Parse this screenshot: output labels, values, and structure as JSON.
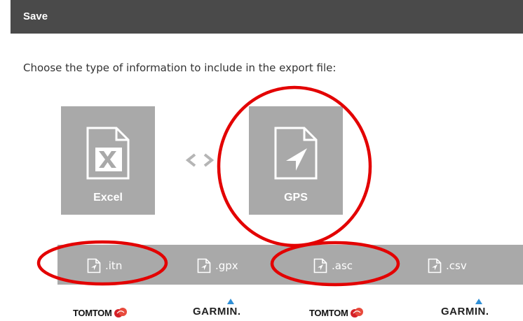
{
  "dialog": {
    "title": "Save"
  },
  "instructions": "Choose the type of information to include in the export file:",
  "tiles": [
    {
      "label": "Excel",
      "icon": "excel-doc-icon"
    },
    {
      "label": "GPS",
      "icon": "gps-doc-icon"
    }
  ],
  "toggle_icon": "swap-arrows-icon",
  "formats": [
    {
      "label": ".itn",
      "icon": "file-gps-icon"
    },
    {
      "label": ".gpx",
      "icon": "file-gps-icon"
    },
    {
      "label": ".asc",
      "icon": "file-gps-icon"
    },
    {
      "label": ".csv",
      "icon": "file-gps-icon"
    }
  ],
  "brands": [
    {
      "name": "TOMTOM"
    },
    {
      "name": "GARMIN."
    },
    {
      "name": "TOMTOM"
    },
    {
      "name": "GARMIN."
    }
  ],
  "colors": {
    "titlebar": "#4a4a4a",
    "tile": "#a9a9a9",
    "annotation": "#e30000",
    "garmin_accent": "#2f8fd6",
    "tomtom_accent": "#d42027"
  }
}
